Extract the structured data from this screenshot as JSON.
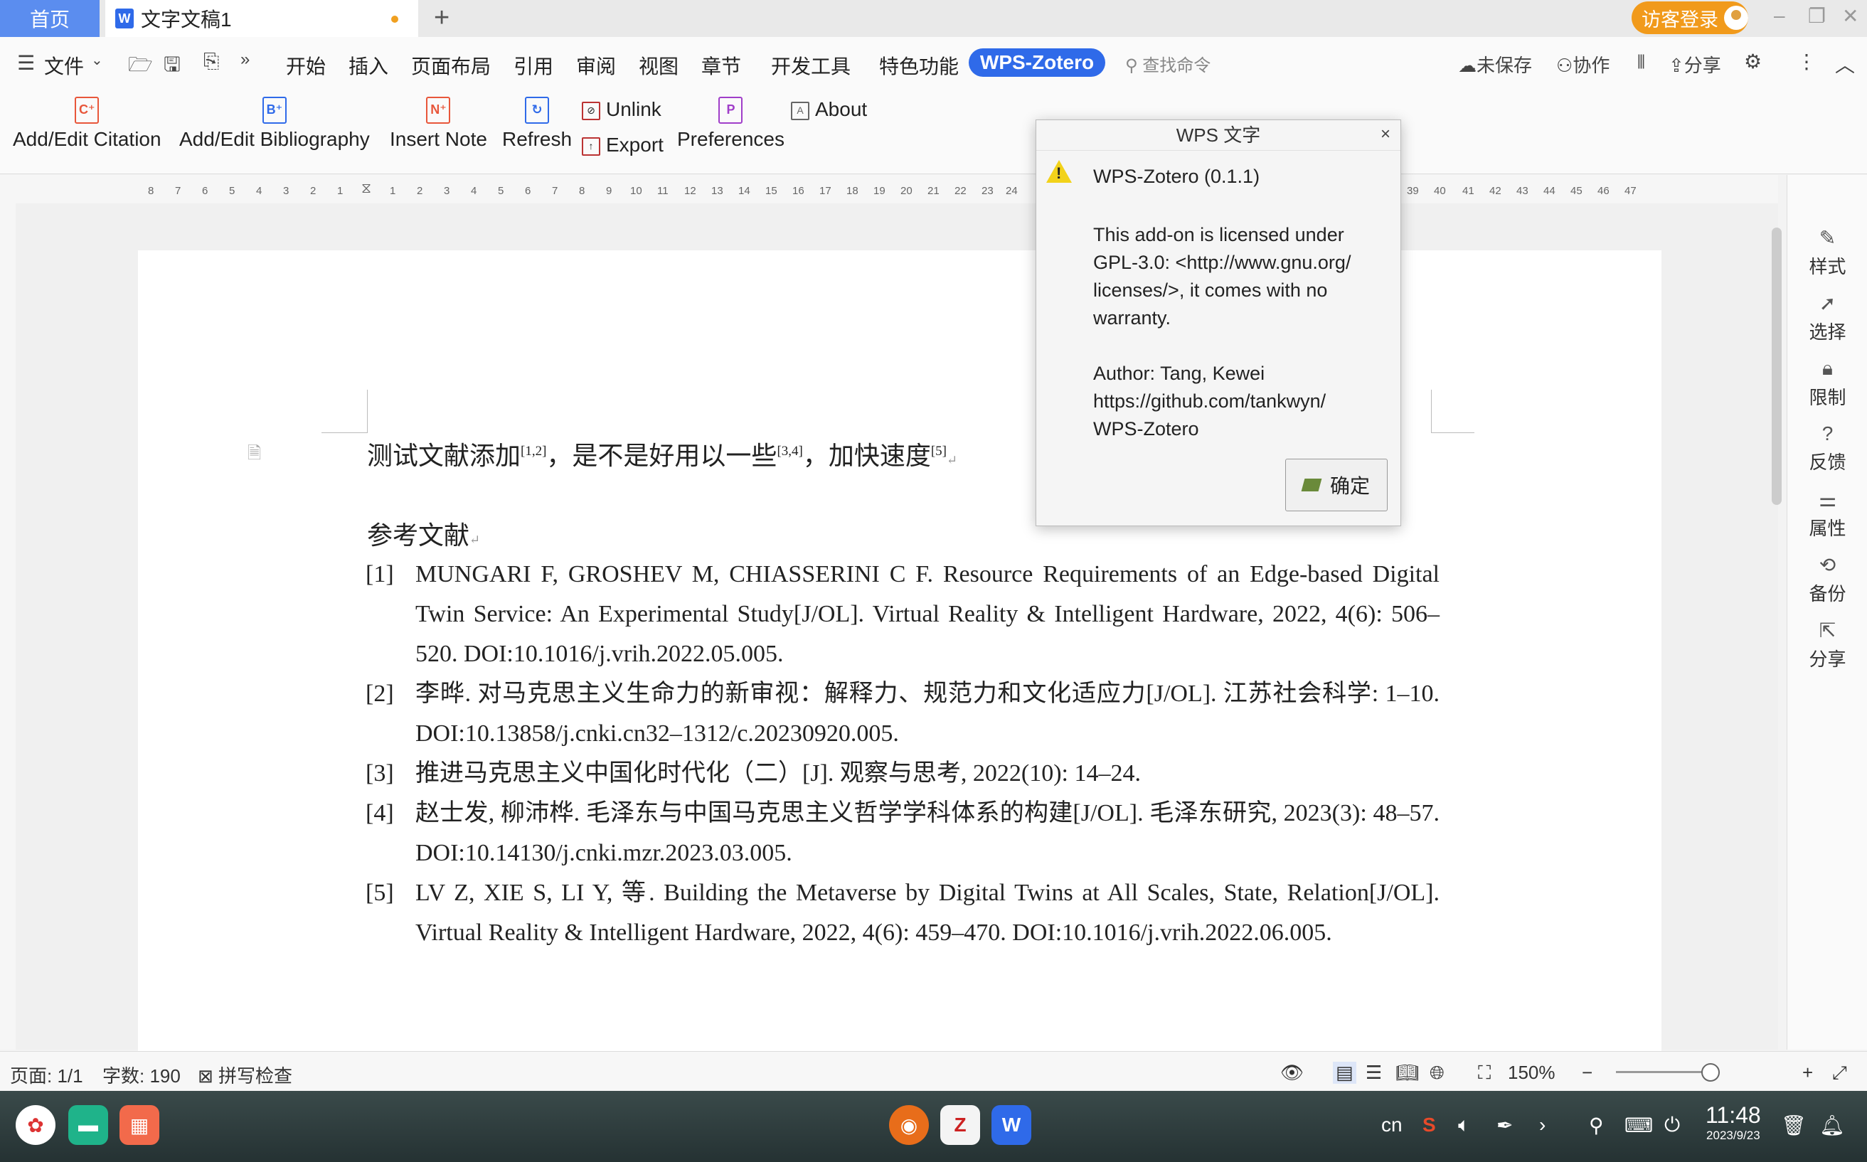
{
  "tabs": {
    "home": "首页",
    "document": "文字文稿1",
    "add": "+",
    "guest": "访客登录"
  },
  "menu": {
    "file": "文件",
    "items": [
      "开始",
      "插入",
      "页面布局",
      "引用",
      "审阅",
      "视图",
      "章节",
      "开发工具",
      "特色功能"
    ],
    "active": "WPS-Zotero",
    "search_placeholder": "查找命令",
    "unsaved": "未保存",
    "collab": "协作",
    "share": "分享"
  },
  "ribbon": {
    "add_edit_citation": "Add/Edit Citation",
    "add_edit_bibliography": "Add/Edit Bibliography",
    "insert_note": "Insert Note",
    "refresh": "Refresh",
    "unlink": "Unlink",
    "export": "Export",
    "preferences": "Preferences",
    "about": "About"
  },
  "ruler": {
    "left": [
      "8",
      "7",
      "6",
      "5",
      "4",
      "3",
      "2",
      "1"
    ],
    "right": [
      "1",
      "2",
      "3",
      "4",
      "5",
      "6",
      "7",
      "8",
      "9",
      "10",
      "11",
      "12",
      "13",
      "14",
      "15",
      "16",
      "17",
      "18",
      "19",
      "20",
      "21",
      "22",
      "23",
      "24"
    ],
    "right2": [
      "39",
      "40",
      "41",
      "42",
      "43",
      "44",
      "45",
      "46",
      "47"
    ]
  },
  "document": {
    "seg1": "测试文献添加",
    "sup1": "[1,2]",
    "seg2": "，是不是好用以一些",
    "sup2": "[3,4]",
    "seg3": "，加快速度",
    "sup3": "[5]",
    "ref_title": "参考文献",
    "references": [
      {
        "num": "[1]",
        "text": "MUNGARI F, GROSHEV M, CHIASSERINI C F. Resource Requirements of an Edge-based Digital Twin Service: An Experimental Study[J/OL]. Virtual Reality & Intelligent Hardware, 2022, 4(6): 506–520. DOI:10.1016/j.vrih.2022.05.005."
      },
      {
        "num": "[2]",
        "text": "李晔. 对马克思主义生命力的新审视：解释力、规范力和文化适应力[J/OL]. 江苏社会科学: 1–10. DOI:10.13858/j.cnki.cn32–1312/c.20230920.005."
      },
      {
        "num": "[3]",
        "text": "推进马克思主义中国化时代化（二）[J]. 观察与思考, 2022(10): 14–24."
      },
      {
        "num": "[4]",
        "text": "赵士发, 柳沛桦. 毛泽东与中国马克思主义哲学学科体系的构建[J/OL]. 毛泽东研究, 2023(3): 48–57. DOI:10.14130/j.cnki.mzr.2023.03.005."
      },
      {
        "num": "[5]",
        "text": "LV Z, XIE S, LI Y, 等. Building the Metaverse by Digital Twins at All Scales, State, Relation[J/OL]. Virtual Reality & Intelligent Hardware, 2022, 4(6): 459–470. DOI:10.1016/j.vrih.2022.06.005."
      }
    ]
  },
  "sidebar": [
    "样式",
    "选择",
    "限制",
    "反馈",
    "属性",
    "备份",
    "分享"
  ],
  "status": {
    "page": "页面: 1/1",
    "words": "字数: 190",
    "spell": "拼写检查",
    "zoom": "150%",
    "minus": "−",
    "plus": "+"
  },
  "taskbar": {
    "lang": "cn",
    "time": "11:48",
    "date": "2023/9/23"
  },
  "dialog": {
    "title": "WPS 文字",
    "close": "×",
    "heading": "WPS-Zotero (0.1.1)",
    "body": "This add-on is licensed under\nGPL-3.0: <http://www.gnu.org/\nlicenses/>, it comes with no\nwarranty.\n\nAuthor: Tang, Kewei\nhttps://github.com/tankwyn/\nWPS-Zotero",
    "ok": "确定"
  },
  "colors": {
    "accent": "#2f6ae9",
    "guest": "#f19a1b",
    "warning": "#f2d21a"
  }
}
